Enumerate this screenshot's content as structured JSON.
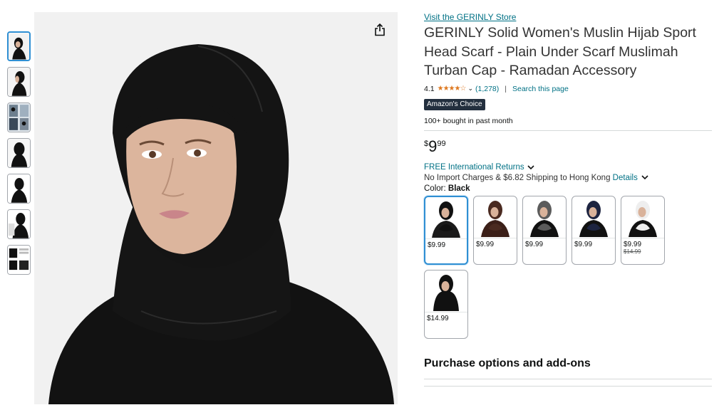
{
  "thumbnails": [
    {
      "name": "thumb-black-front",
      "active": true
    },
    {
      "name": "thumb-black-side",
      "active": false
    },
    {
      "name": "thumb-lifestyle",
      "active": false
    },
    {
      "name": "thumb-black-back",
      "active": false
    },
    {
      "name": "thumb-silhouette",
      "active": false
    },
    {
      "name": "thumb-silhouette-2",
      "active": false
    },
    {
      "name": "thumb-size-chart",
      "active": false
    }
  ],
  "product": {
    "store_link": "Visit the GERINLY Store",
    "title": "GERINLY Solid Women's Muslin Hijab Sport Head Scarf - Plain Under Scarf Muslimah Turban Cap - Ramadan Accessory",
    "rating": "4.1",
    "stars": "★★★★☆",
    "rating_count": "(1,278)",
    "separator": "|",
    "search_page": "Search this page",
    "badge": "Amazon's Choice",
    "bought": "100+ bought in past month",
    "price": {
      "symbol": "$",
      "whole": "9",
      "fraction": "99"
    },
    "returns": "FREE International Returns",
    "shipping_text": "No Import Charges & $6.82 Shipping to Hong Kong",
    "shipping_details": "Details",
    "color_label": "Color:",
    "color_value": "Black"
  },
  "swatches": [
    {
      "price": "$9.99",
      "strike": "",
      "color": "#111111",
      "accent": "#1a1a1a",
      "selected": true
    },
    {
      "price": "$9.99",
      "strike": "",
      "color": "#4a2a20",
      "accent": "#3b1f18",
      "selected": false
    },
    {
      "price": "$9.99",
      "strike": "",
      "color": "#5b5b5b",
      "accent": "#111111",
      "selected": false
    },
    {
      "price": "$9.99",
      "strike": "",
      "color": "#1d2440",
      "accent": "#111111",
      "selected": false
    },
    {
      "price": "$9.99",
      "strike": "$14.99",
      "color": "#eeeeee",
      "accent": "#111111",
      "selected": false
    },
    {
      "price": "$14.99",
      "strike": "",
      "color": "#111111",
      "accent": "#111111",
      "selected": false
    }
  ],
  "purchase_heading": "Purchase options and add-ons",
  "colors": {
    "link": "#007185",
    "star": "#de7921",
    "selected_border": "#2f8fd3",
    "badge_bg": "#232f3e"
  }
}
